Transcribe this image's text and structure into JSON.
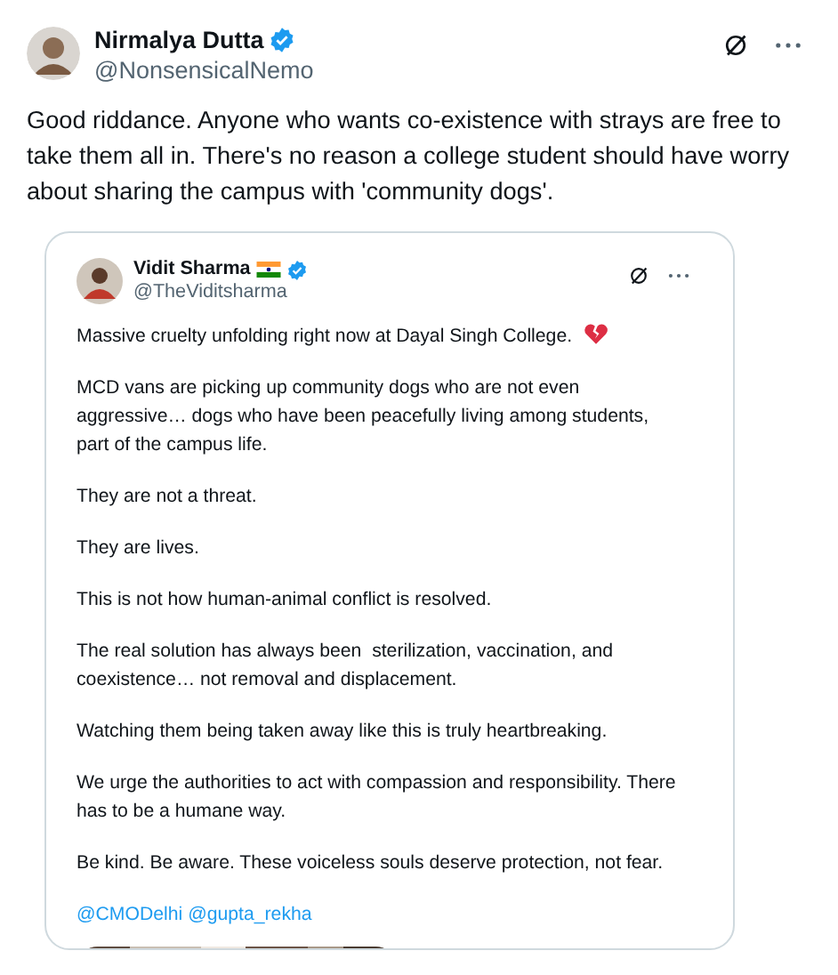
{
  "author": {
    "name": "Nirmalya Dutta",
    "handle": "@NonsensicalNemo",
    "verified": true
  },
  "text": "Good riddance. Anyone who wants co-existence with strays are free to take them all in. There's no reason a college student should have worry about sharing the campus with 'community dogs'.",
  "quoted": {
    "author": {
      "name": "Vidit Sharma",
      "handle": "@TheViditsharma",
      "verified": true
    },
    "paragraphs": [
      {
        "text": "Massive cruelty unfolding right now at Dayal Singh College.",
        "kind": "heart"
      },
      {
        "text": "MCD vans are picking up community dogs who are not even aggressive… dogs who have been peacefully living among students, part of the campus life.",
        "kind": "plain"
      },
      {
        "text": "They are not a threat.",
        "kind": "plain"
      },
      {
        "text": "They are lives.",
        "kind": "plain"
      },
      {
        "text": "This is not how human-animal conflict is resolved.",
        "kind": "plain"
      },
      {
        "text": "The real solution has always been  sterilization, vaccination, and coexistence… not removal and displacement.",
        "kind": "plain"
      },
      {
        "text": "Watching them being taken away like this is truly heartbreaking.",
        "kind": "plain"
      },
      {
        "text": "We urge the authorities to act with compassion and responsibility. There has to be a humane way.",
        "kind": "plain"
      },
      {
        "text": "Be kind. Be aware. These voiceless souls deserve protection, not fear.",
        "kind": "plain"
      }
    ],
    "mentions": [
      "@CMODelhi",
      "@gupta_rekha"
    ]
  }
}
